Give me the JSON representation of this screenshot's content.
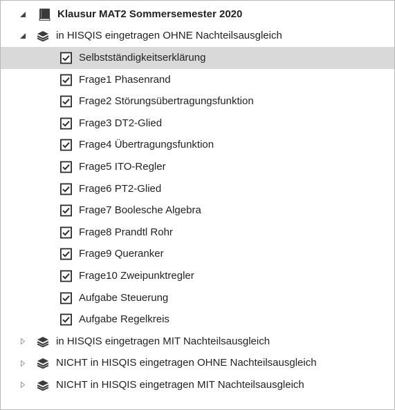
{
  "tree": {
    "root": {
      "label": "Klausur MAT2 Sommersemester 2020",
      "icon": "book-icon",
      "expanded": true
    },
    "groups": [
      {
        "label": "in HISQIS eingetragen OHNE Nachteilsausgleich",
        "icon": "layers-icon",
        "expanded": true,
        "items": [
          {
            "label": "Selbstständigkeitserklärung",
            "checked": true,
            "selected": true
          },
          {
            "label": "Frage1 Phasenrand",
            "checked": true
          },
          {
            "label": "Frage2 Störungsübertragungsfunktion",
            "checked": true
          },
          {
            "label": "Frage3 DT2-Glied",
            "checked": true
          },
          {
            "label": "Frage4 Übertragungsfunktion",
            "checked": true
          },
          {
            "label": "Frage5 ITO-Regler",
            "checked": true
          },
          {
            "label": "Frage6 PT2-Glied",
            "checked": true
          },
          {
            "label": "Frage7 Boolesche Algebra",
            "checked": true
          },
          {
            "label": "Frage8 Prandtl Rohr",
            "checked": true
          },
          {
            "label": "Frage9 Queranker",
            "checked": true
          },
          {
            "label": "Frage10 Zweipunktregler",
            "checked": true
          },
          {
            "label": "Aufgabe Steuerung",
            "checked": true
          },
          {
            "label": "Aufgabe Regelkreis",
            "checked": true
          }
        ]
      },
      {
        "label": "in HISQIS eingetragen MIT Nachteilsausgleich",
        "icon": "layers-icon",
        "expanded": false
      },
      {
        "label": "NICHT in HISQIS eingetragen OHNE Nachteilsausgleich",
        "icon": "layers-icon",
        "expanded": false
      },
      {
        "label": "NICHT in HISQIS eingetragen MIT Nachteilsausgleich",
        "icon": "layers-icon",
        "expanded": false
      }
    ]
  },
  "colors": {
    "selected_row": "#d9d9d9",
    "icon_dark": "#3a3a3a",
    "twisty_expanded": "#444444",
    "twisty_collapsed": "#9a9a9a",
    "border": "#b8b8b8"
  }
}
